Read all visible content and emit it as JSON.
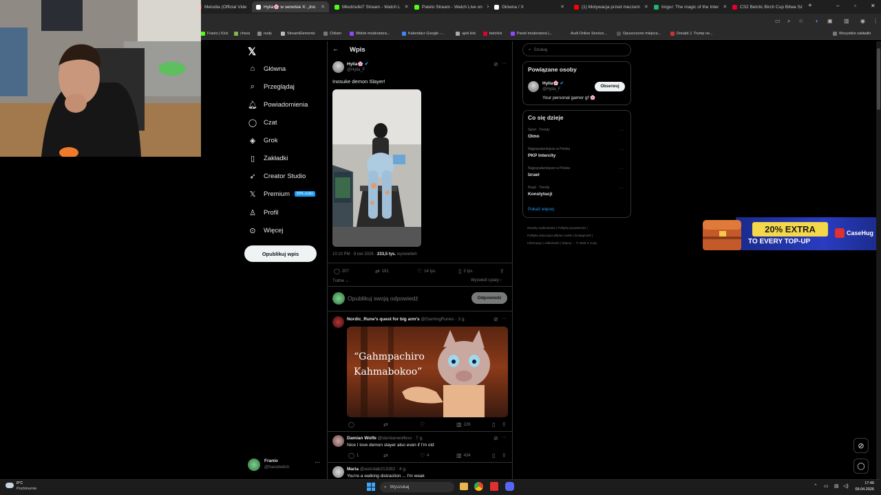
{
  "browser": {
    "tabs": [
      {
        "label": "Melodia (Official Vide",
        "color": "#ff0000"
      },
      {
        "label": "Hylia🌸 w serwisie X: „Ino",
        "color": "#ffffff",
        "active": true
      },
      {
        "label": "Młodziutki7 Stream - Watch L",
        "color": "#53fc18"
      },
      {
        "label": "Patelo Stream - Watch Live on",
        "color": "#53fc18"
      },
      {
        "label": "Główna / X",
        "color": "#ffffff"
      },
      {
        "label": "(1) Motywacja przed meczem",
        "color": "#ff0000"
      },
      {
        "label": "Imgur: The magic of the Inter",
        "color": "#1bb76e"
      },
      {
        "label": "CS2 Betclic Birch Cup Bitwa Sz",
        "color": "#e4002b"
      }
    ],
    "bookmarks": [
      "Franio | Kick",
      "chess",
      "nudy",
      "StreamElements",
      "Chilam",
      "Widok moderatora...",
      "Kalendarz Google -...",
      "ujeb link",
      "betclick",
      "Panel moderatora |...",
      "Audi Online Service...",
      "Opuszczone miejsca...",
      "Donald J. Trump ne..."
    ],
    "all_bookmarks": "Wszystkie zakładki"
  },
  "nav": {
    "items": [
      {
        "label": "Główna",
        "icon": "home-icon",
        "glyph": "⌂"
      },
      {
        "label": "Przeglądaj",
        "icon": "search-icon",
        "glyph": "⌕"
      },
      {
        "label": "Powiadomienia",
        "icon": "bell-icon",
        "glyph": "♫"
      },
      {
        "label": "Czat",
        "icon": "chat-icon",
        "glyph": "◯"
      },
      {
        "label": "Grok",
        "icon": "grok-icon",
        "glyph": "◈"
      },
      {
        "label": "Zakładki",
        "icon": "bookmark-icon",
        "glyph": "▯"
      },
      {
        "label": "Creator Studio",
        "icon": "rocket-icon",
        "glyph": "➶"
      },
      {
        "label": "Premium",
        "icon": "x-premium-icon",
        "glyph": "𝕏"
      },
      {
        "label": "Profil",
        "icon": "profile-icon",
        "glyph": "♙"
      },
      {
        "label": "Więcej",
        "icon": "more-icon",
        "glyph": "⊙"
      }
    ],
    "premium_badge": "50% zniżki",
    "post_button": "Opublikuj wpis",
    "account_name": "Franio",
    "account_handle": "@franiotwitch"
  },
  "header": {
    "title": "Wpis"
  },
  "post": {
    "name": "Hylia🌸",
    "handle": "@Hylia_F",
    "text": "Inosuke demon Slayer!",
    "time": "10:10 PM · 8 kwi 2026 · ",
    "views_count": "233,5 tys.",
    "views_label": " wyświetleń",
    "replies": "207",
    "reposts": "191",
    "likes": "14 tys.",
    "bookmarks": "2 tys.",
    "sort": "Trafne",
    "quotes": "Wyświetl cytaty",
    "reply_placeholder": "Opublikuj swoją odpowiedź",
    "reply_button": "Odpowiedz"
  },
  "replies": [
    {
      "name": "Nordic_Rune's quest for big arm's",
      "handle": "@GamingRunes · 3 g.",
      "image_caption": "“Gahmpachiro\nKahmabokoo”",
      "views": "226"
    },
    {
      "name": "Damian Wolfe",
      "handle": "@damianwolfexx · 7 g.",
      "text": "Nice I love demon slayer also even if I'm old",
      "replies": "1",
      "likes": "4",
      "views": "434"
    },
    {
      "name": "Maria",
      "handle": "@astrolab213282 · 4 g.",
      "text": "You're a walking distraction ... I'm weak"
    }
  ],
  "right": {
    "search_placeholder": "Szukaj",
    "related_title": "Powiązane osoby",
    "related": {
      "name": "Hylia🌸",
      "handle": "@Hylia_F",
      "bio": "Your personal gamer gf 🌸",
      "follow": "Obserwuj"
    },
    "trends_title": "Co się dzieje",
    "trends": [
      {
        "cat": "Sport · Trendy",
        "name": "Olmo"
      },
      {
        "cat": "Najpopularniejsze w Polska",
        "name": "PKP Intercity"
      },
      {
        "cat": "Najpopularniejsze w Polska",
        "name": "Izrael"
      },
      {
        "cat": "Rząd · Trendy",
        "name": "Konstytucji"
      }
    ],
    "show_more": "Pokaż więcej",
    "footer": [
      "Zasady użytkowania",
      "Polityka prywatności",
      "Polityka dotycząca plików cookie",
      "Dostępność",
      "Informacje o reklamach",
      "Więcej ···",
      "© 2026 X Corp."
    ]
  },
  "ad": {
    "headline": "20% EXTRA",
    "subline": "TO EVERY TOP-UP",
    "brand": "CaseHug"
  },
  "taskbar": {
    "weather_temp": "8°C",
    "weather_desc": "Pochmurnie",
    "search": "Wyszukaj",
    "time": "17:46",
    "date": "09.04.2026"
  }
}
